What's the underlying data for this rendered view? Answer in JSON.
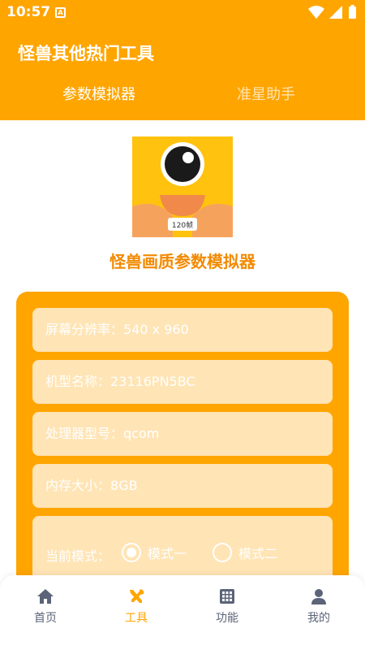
{
  "status_bar": {
    "time": "10:57",
    "a_icon": "A"
  },
  "header": {
    "title": "怪兽其他热门工具",
    "tabs": [
      {
        "label": "参数模拟器",
        "active": true
      },
      {
        "label": "准星助手",
        "active": false
      }
    ]
  },
  "logo": {
    "badge_text": "120帧"
  },
  "page_title": "怪兽画质参数模拟器",
  "fields": [
    {
      "label": "屏幕分辨率：",
      "value": "540 x 960"
    },
    {
      "label": "机型名称：",
      "value": "23116PN5BC"
    },
    {
      "label": "处理器型号：",
      "value": "qcom"
    },
    {
      "label": "内存大小：",
      "value": "8GB"
    }
  ],
  "mode": {
    "label": "当前模式：",
    "options": [
      {
        "label": "模式一",
        "checked": true
      },
      {
        "label": "模式二",
        "checked": false
      }
    ]
  },
  "bottom_nav": [
    {
      "label": "首页",
      "icon": "home-icon",
      "active": false
    },
    {
      "label": "工具",
      "icon": "tools-icon",
      "active": true
    },
    {
      "label": "功能",
      "icon": "grid-icon",
      "active": false
    },
    {
      "label": "我的",
      "icon": "person-icon",
      "active": false
    }
  ],
  "colors": {
    "primary": "#FFA500",
    "field_bg": "#FFE4B5",
    "title_orange": "#F28A00",
    "nav_inactive": "#5B6478"
  }
}
